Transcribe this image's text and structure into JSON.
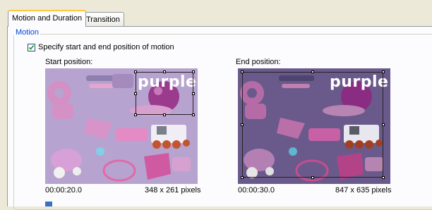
{
  "tabs": [
    {
      "label": "Motion and Duration",
      "active": true
    },
    {
      "label": "Transition",
      "active": false
    }
  ],
  "motion_group": {
    "legend": "Motion"
  },
  "specify_checkbox": {
    "label": "Specify start and end position of motion",
    "checked": true
  },
  "start": {
    "label": "Start position:",
    "time": "00:00:20.0",
    "size": "348 x 261 pixels",
    "watermark": "purple"
  },
  "end": {
    "label": "End position:",
    "time": "00:00:30.0",
    "size": "847 x 635 pixels",
    "watermark": "purple"
  },
  "colors": {
    "accent": "#0046d5",
    "tab_highlight": "#ffc83c",
    "photo_bg": "#b19ac8"
  }
}
